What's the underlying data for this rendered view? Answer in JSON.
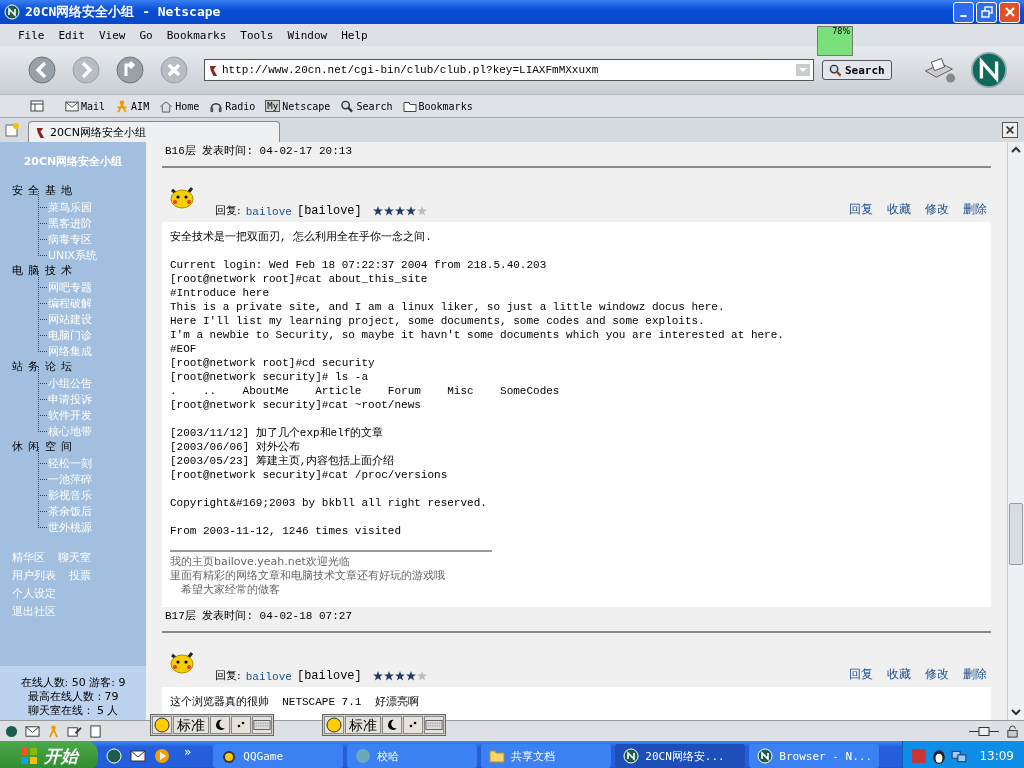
{
  "window": {
    "title": "20CN网络安全小组 - Netscape"
  },
  "menu": [
    "File",
    "Edit",
    "View",
    "Go",
    "Bookmarks",
    "Tools",
    "Window",
    "Help"
  ],
  "address": {
    "value": "http://www.20cn.net/cgi-bin/club/club.pl?key=LIAXFmMXxuxm"
  },
  "search_button": "Search",
  "meter": "78%",
  "personal_toolbar": [
    {
      "kind": "mail",
      "label": "Mail"
    },
    {
      "kind": "aim",
      "label": "AIM"
    },
    {
      "kind": "home",
      "label": "Home"
    },
    {
      "kind": "radio",
      "label": "Radio"
    },
    {
      "kind": "my",
      "label": "Netscape",
      "badge": "My"
    },
    {
      "kind": "search",
      "label": "Search"
    },
    {
      "kind": "folder",
      "label": "Bookmarks"
    }
  ],
  "tab": {
    "title": "20CN网络安全小组",
    "selected": true
  },
  "sidebar": {
    "title": "20CN网络安全小组",
    "sections": [
      {
        "heading": "安 全 基 地",
        "children": [
          "菜鸟乐园",
          "黑客进阶",
          "病毒专区",
          "UNIX系统"
        ]
      },
      {
        "heading": "电 脑 技 术",
        "children": [
          "网吧专题",
          "编程破解",
          "网站建设",
          "电脑门诊",
          "网络集成"
        ]
      },
      {
        "heading": "站 务 论 坛",
        "children": [
          "小组公告",
          "申请投诉",
          "软件开发",
          "核心地带"
        ]
      },
      {
        "heading": "休 闲 空 间",
        "children": [
          "轻松一刻",
          "一池萍碎",
          "影视音乐",
          "茶余饭后",
          "世外桃源"
        ]
      }
    ],
    "links": [
      [
        "精华区",
        "聊天室"
      ],
      [
        "用户列表",
        "投票"
      ],
      [
        "个人设定"
      ],
      [
        "退出社区"
      ]
    ],
    "stats": [
      "在线人数: 50 游客: 9",
      "最高在线人数：79",
      "聊天室在线： 5 人"
    ]
  },
  "top_meta": "B16层 发表时间: 04-02-17 20:13",
  "posts": [
    {
      "reply_label": "回复:",
      "user": "bailove",
      "nick": "[bailove]",
      "stars": 4,
      "actions": [
        "回复",
        "收藏",
        "修改",
        "删除"
      ],
      "body": [
        [
          "安全技术是一把双面刃, 怎么利用全在乎你一念之间."
        ],
        [
          "Current login: Wed Feb 18 07:22:37 2004 from 218.5.40.203",
          "[root@network root]#cat about_this_site",
          "#Introduce here",
          "This is a private site, and I am a linux liker, so just a little windowz docus here.",
          "Here I'll list my learning project, some documents, some codes and some exploits.",
          "I'm a newbie to Security, so maybe it havn't some documents which you are interested at here.",
          "#EOF",
          "[root@network root]#cd security",
          "[root@network security]# ls -a",
          ".    ..    AboutMe    Article    Forum    Misc    SomeCodes",
          "[root@network security]#cat ~root/news"
        ],
        [
          "[2003/11/12] 加了几个exp和elf的文章",
          "[2003/06/06] 对外公布",
          "[2003/05/23] 筹建主页,内容包括上面介绍",
          "[root@network security]#cat /proc/versions"
        ],
        [
          "Copyright&#169;2003 by bkbll all right reserved."
        ],
        [
          "From 2003-11-12, 1246 times visited"
        ]
      ],
      "signature": [
        "我的主页bailove.yeah.net欢迎光临",
        "里面有精彩的网络文章和电脑技术文章还有好玩的游戏哦",
        "　希望大家经常的做客"
      ],
      "footer": "B17层 发表时间: 04-02-18 07:27"
    },
    {
      "reply_label": "回复:",
      "user": "bailove",
      "nick": "[bailove]",
      "stars": 4,
      "actions": [
        "回复",
        "收藏",
        "修改",
        "删除"
      ],
      "body": [
        [
          "这个浏览器真的很帅  NETSCAPE 7.1  好漂亮啊"
        ]
      ]
    }
  ],
  "ime_bars": [
    {
      "label": "标准"
    },
    {
      "label": "标准"
    }
  ],
  "taskbar": {
    "start": "开始",
    "more": "»",
    "tasks": [
      {
        "kind": "game",
        "label": "QQGame",
        "selected": false
      },
      {
        "kind": "app",
        "label": "校哈",
        "selected": false
      },
      {
        "kind": "folder",
        "label": "共享文档",
        "selected": false
      },
      {
        "kind": "netscape",
        "label": "20CN网络安...",
        "selected": true
      },
      {
        "kind": "netscape",
        "label": "Browser - N...",
        "selected": false
      }
    ],
    "clock": "13:09"
  }
}
